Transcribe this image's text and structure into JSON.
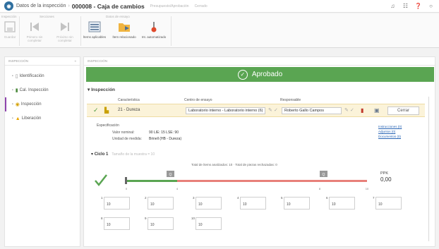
{
  "header": {
    "app_logo": "logo-icon",
    "breadcrumb_parent": "Datos de la inspección",
    "page_title": "000008 - Caja de cambios",
    "meta_user": "Presupuesto/Aprobación",
    "meta_status": "Cerrado"
  },
  "ribbon": {
    "group_labels": [
      "Inspección",
      "Secciones",
      "Datos de ensayo"
    ],
    "buttons": [
      "Guardar",
      "Primero sin completar",
      "Próximo sin completar",
      "Ítems aplicables",
      "Ítem relacionado",
      "Int. automatizado"
    ]
  },
  "sidebar": {
    "title": "INSPECCIÓN",
    "items": [
      {
        "label": "Identificación"
      },
      {
        "label": "Cal. Inspección"
      },
      {
        "label": "Inspección"
      },
      {
        "label": "Liberación"
      }
    ]
  },
  "main": {
    "section_header": "INSPECCIÓN",
    "status_label": "Aprobado",
    "inspection_title": "Inspección",
    "columns": [
      "Característica",
      "Centro de ensayo",
      "Responsable"
    ],
    "row": {
      "characteristic": "21 - Dureza",
      "center": "Laboratorio interno - Laboratorio interno (6)",
      "responsible": "Roberto Gallo Campos",
      "close_button": "Cerrar"
    },
    "spec": {
      "title": "Especificación",
      "nominal_label": "Valor nominal:",
      "nominal_value": "90 LIE: 15 LSE: 90",
      "unit_label": "Unidad de medida:",
      "unit_value": "Brinell (HB - Dureza)"
    },
    "links": [
      "Instrucciones (0)",
      "Adjuntos (0)",
      "Documentos (0)"
    ],
    "cycle": {
      "title": "Ciclo 1",
      "sample_size_label": "Tamaño de la muestra = 10",
      "gauge_caption": "Total de ítems analizados: 10 · Total de piezas rechazadas: 0",
      "tick_labels": [
        "0",
        "4",
        "8",
        "10"
      ],
      "marker_labels": [
        "Q",
        "Q"
      ],
      "ppk_label": "PPK",
      "ppk_value": "0,00",
      "samples": [
        {
          "n": "1",
          "value": "10"
        },
        {
          "n": "2",
          "value": "10"
        },
        {
          "n": "3",
          "value": "10"
        },
        {
          "n": "4",
          "value": "10"
        },
        {
          "n": "5",
          "value": "10"
        },
        {
          "n": "6",
          "value": "10"
        },
        {
          "n": "7",
          "value": "10"
        },
        {
          "n": "8",
          "value": "10"
        },
        {
          "n": "9",
          "value": "10"
        },
        {
          "n": "10",
          "value": "10"
        }
      ]
    }
  },
  "colors": {
    "accent": "#5aa552",
    "track_red": "#e8807a",
    "row_highlight": "#fbf3d9"
  }
}
